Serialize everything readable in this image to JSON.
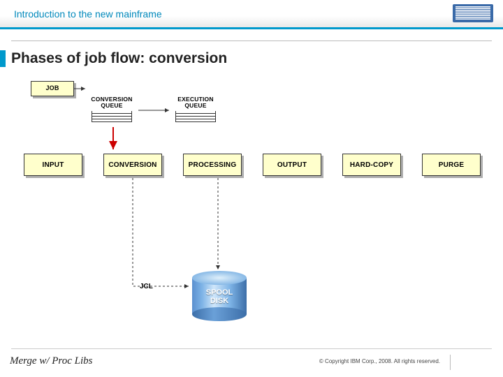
{
  "header": {
    "title": "Introduction to the new mainframe",
    "logo_name": "ibm-logo"
  },
  "slide": {
    "title": "Phases of job flow: conversion"
  },
  "diagram": {
    "job_box": "JOB",
    "queues": {
      "conversion": "CONVERSION\nQUEUE",
      "execution": "EXECUTION\nQUEUE"
    },
    "phases": [
      "INPUT",
      "CONVERSION",
      "PROCESSING",
      "OUTPUT",
      "HARD-COPY",
      "PURGE"
    ],
    "jcl_label": "JCL",
    "spool": "SPOOL\nDISK"
  },
  "footer": {
    "note": "Merge w/ Proc Libs",
    "copyright": "© Copyright IBM Corp., 2008. All rights reserved."
  }
}
